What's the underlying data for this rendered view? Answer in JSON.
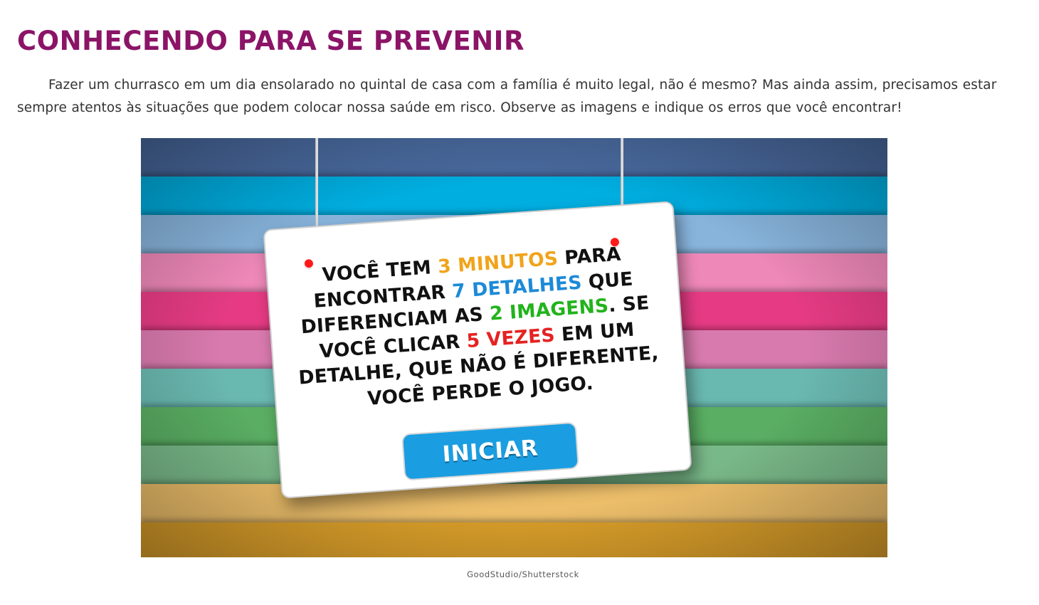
{
  "page": {
    "title": "CONHECENDO PARA SE PREVENIR",
    "intro": "Fazer um churrasco em um dia ensolarado no quintal de casa com a família é muito legal, não é mesmo? Mas ainda assim, precisamos estar sempre atentos às situações que podem colocar nossa saúde em risco. Observe as imagens e indique os erros que você encontrar!"
  },
  "game": {
    "instructions": {
      "part1": "VOCÊ TEM ",
      "time": "3 MINUTOS",
      "part2": " PARA ENCONTRAR ",
      "details": "7 DETALHES",
      "part3": " QUE DIFERENCIAM AS ",
      "images": "2 IMAGENS",
      "part4": ". SE VOCÊ CLICAR ",
      "clicks": "5 VEZES",
      "part5": " EM UM DETALHE, QUE NÃO É DIFERENTE, VOCÊ PERDE O JOGO."
    },
    "start_button_label": "INICIAR",
    "stripes": [
      "#4a6ba0",
      "#00aee0",
      "#88b4dc",
      "#ee88b8",
      "#e63b84",
      "#d97aae",
      "#6ab9b1",
      "#5aae63",
      "#79b888",
      "#ecbe6a",
      "#d99e2a"
    ],
    "colors": {
      "highlight_time": "#f0a41c",
      "highlight_details": "#1c8ad8",
      "highlight_images": "#22b31c",
      "highlight_clicks": "#e52222",
      "button": "#1a9ee1",
      "pin": "#ff1a1a"
    }
  },
  "credit": "GoodStudio/Shutterstock",
  "colors": {
    "title": "#8b1467",
    "body_text": "#333333"
  }
}
